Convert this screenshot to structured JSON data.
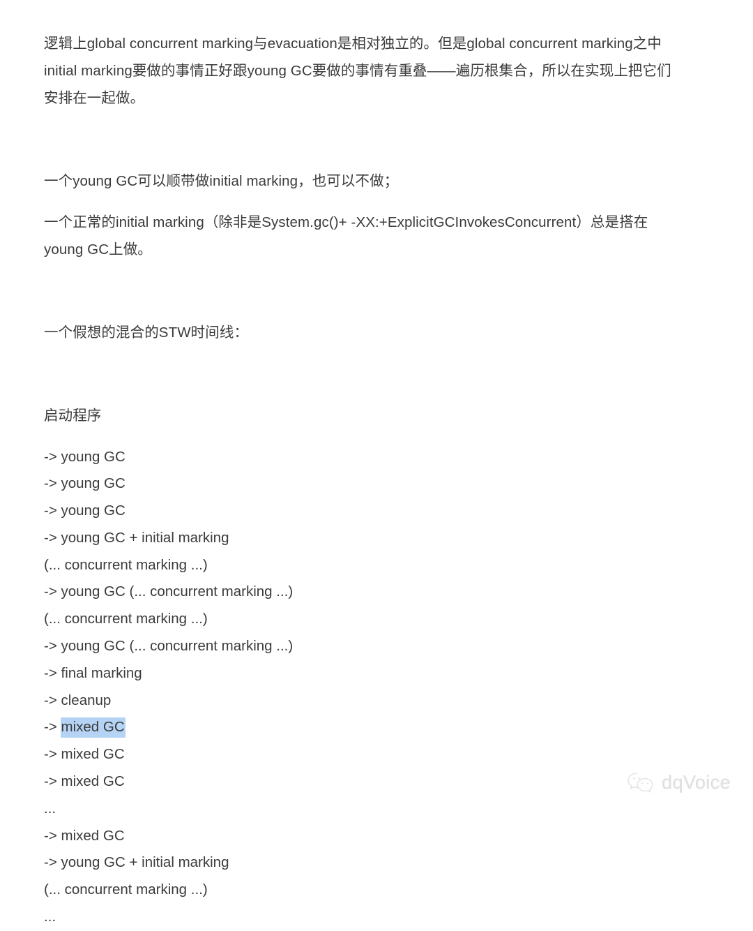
{
  "document": {
    "paragraphs": [
      "逻辑上global concurrent marking与evacuation是相对独立的。但是global concurrent marking之中initial marking要做的事情正好跟young GC要做的事情有重叠——遍历根集合，所以在实现上把它们安排在一起做。",
      "一个young GC可以顺带做initial marking，也可以不做；",
      "一个正常的initial marking（除非是System.gc()+ -XX:+ExplicitGCInvokesConcurrent）总是搭在young GC上做。",
      "一个假想的混合的STW时间线："
    ],
    "timeline_heading": "启动程序",
    "timeline": [
      {
        "text": "-> young GC",
        "highlighted": false
      },
      {
        "text": "-> young GC",
        "highlighted": false
      },
      {
        "text": "-> young GC",
        "highlighted": false
      },
      {
        "text": "-> young GC + initial marking",
        "highlighted": false
      },
      {
        "text": "(... concurrent marking ...)",
        "highlighted": false
      },
      {
        "text": "-> young GC (... concurrent marking ...)",
        "highlighted": false
      },
      {
        "text": "(... concurrent marking ...)",
        "highlighted": false
      },
      {
        "text": "-> young GC (... concurrent marking ...)",
        "highlighted": false
      },
      {
        "text": "-> final marking",
        "highlighted": false
      },
      {
        "text": "-> cleanup",
        "highlighted": false
      },
      {
        "prefix": "-> ",
        "highlight": "mixed GC",
        "highlighted": true
      },
      {
        "text": "-> mixed GC",
        "highlighted": false
      },
      {
        "text": "-> mixed GC",
        "highlighted": false
      },
      {
        "text": "...",
        "highlighted": false
      },
      {
        "text": "-> mixed GC",
        "highlighted": false
      },
      {
        "text": "-> young GC + initial marking",
        "highlighted": false
      },
      {
        "text": "(... concurrent marking ...)",
        "highlighted": false
      },
      {
        "text": "...",
        "highlighted": false
      }
    ]
  },
  "watermark": {
    "label": "dqVoice",
    "icon": "wechat-logo",
    "text_color": "#c9c9c9"
  },
  "colors": {
    "text": "#3b3b3b",
    "background": "#ffffff",
    "selection_highlight": "#b5d4f5"
  }
}
